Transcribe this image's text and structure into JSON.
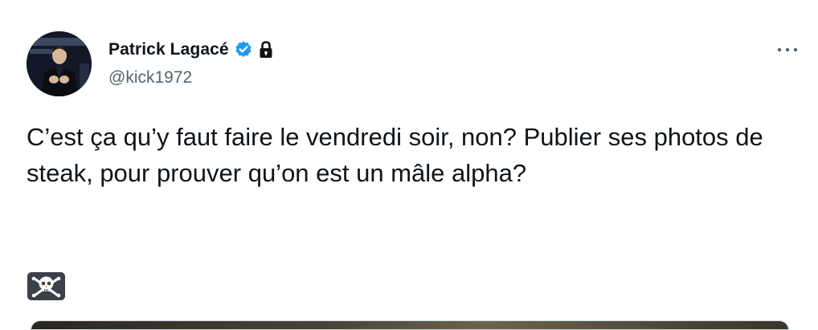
{
  "tweet": {
    "author": {
      "display_name": "Patrick Lagacé",
      "handle": "@kick1972",
      "verified": true,
      "protected": true
    },
    "text": "C’est ça qu’y faut faire le vendredi soir, non? Publier ses photos de steak, pour prouver qu’on est un mâle alpha?",
    "emoji": "skull-and-crossbones-icon",
    "colors": {
      "verified_badge": "#1d9bf0",
      "handle_text": "#536471",
      "body_text": "#0f1419"
    }
  }
}
